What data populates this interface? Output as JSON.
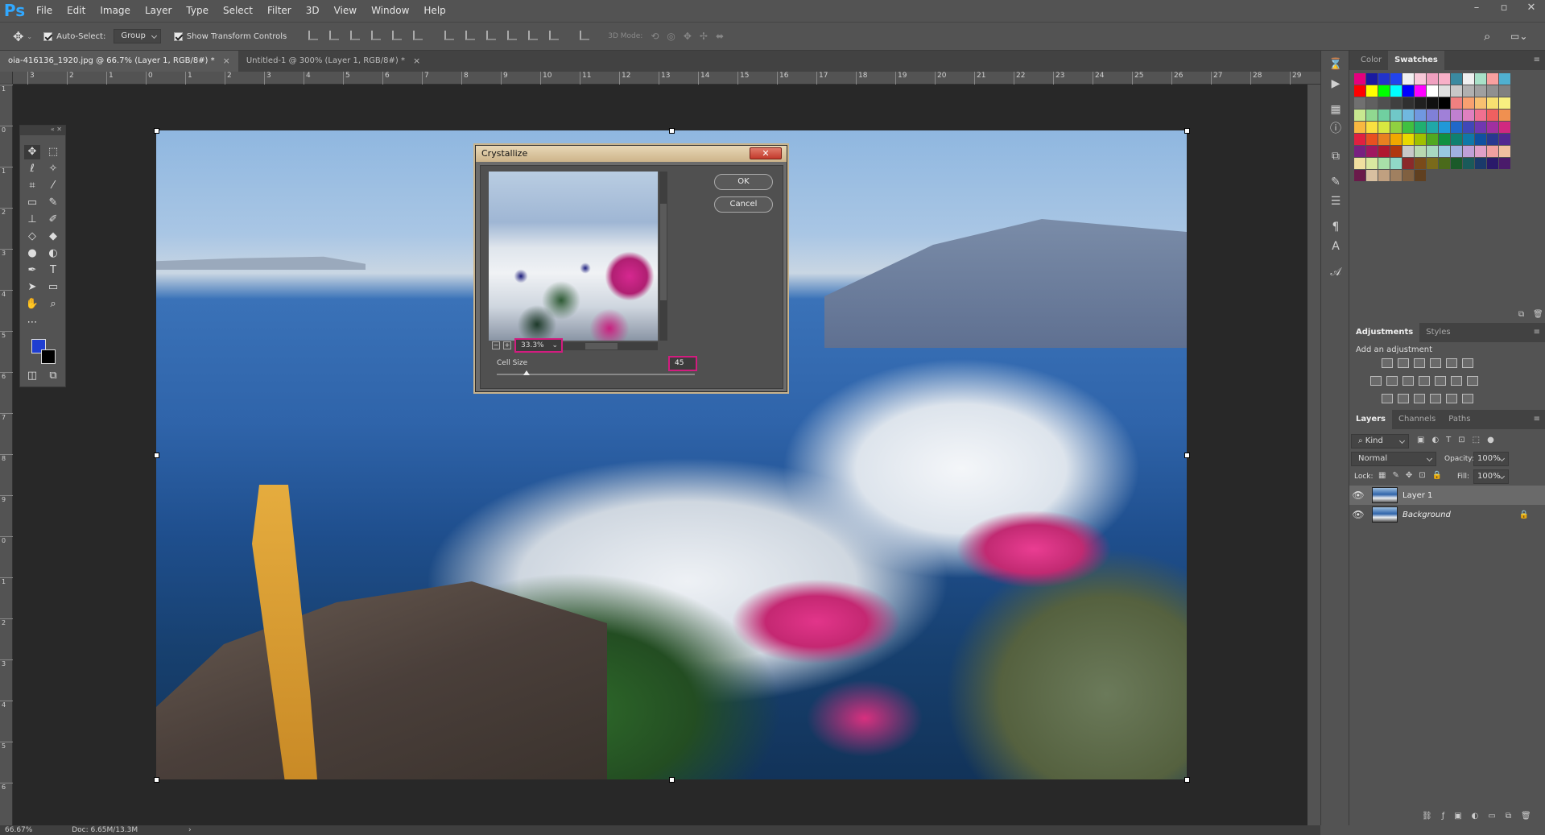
{
  "app": {
    "logo": "Ps"
  },
  "menu": [
    "File",
    "Edit",
    "Image",
    "Layer",
    "Type",
    "Select",
    "Filter",
    "3D",
    "View",
    "Window",
    "Help"
  ],
  "window_controls": [
    "–",
    "▫",
    "✕"
  ],
  "options": {
    "auto_select_label": "Auto-Select:",
    "auto_select_value": "Group",
    "show_transform_label": "Show Transform Controls",
    "mode_3d_label": "3D Mode:"
  },
  "tabs": [
    {
      "label": "oia-416136_1920.jpg @ 66.7% (Layer 1, RGB/8#) *",
      "close": "×"
    },
    {
      "label": "Untitled-1 @ 300% (Layer 1, RGB/8#) *",
      "close": "×"
    }
  ],
  "ruler_h": [
    "3",
    "2",
    "1",
    "0",
    "1",
    "2",
    "3",
    "4",
    "5",
    "6",
    "7",
    "8",
    "9",
    "10",
    "11",
    "12",
    "13",
    "14",
    "15",
    "16",
    "17",
    "18",
    "19",
    "20",
    "21",
    "22",
    "23",
    "24",
    "25",
    "26",
    "27",
    "28",
    "29"
  ],
  "ruler_v": [
    "1",
    "0",
    "1",
    "2",
    "3",
    "4",
    "5",
    "6",
    "7",
    "8",
    "9",
    "0",
    "1",
    "2",
    "3",
    "4",
    "5",
    "6"
  ],
  "dialog": {
    "title": "Crystallize",
    "close": "✕",
    "ok": "OK",
    "cancel": "Cancel",
    "zoom": "33.3%",
    "zoom_out": "−",
    "zoom_in": "+",
    "cell_size_label": "Cell Size",
    "cell_size_value": "45",
    "cell_size_percent": 0.15
  },
  "panels": {
    "color_tab": "Color",
    "swatches_tab": "Swatches",
    "adjustments_tab": "Adjustments",
    "styles_tab": "Styles",
    "add_adjustment": "Add an adjustment",
    "layers_tab": "Layers",
    "channels_tab": "Channels",
    "paths_tab": "Paths",
    "kind": "Kind",
    "blend_mode": "Normal",
    "opacity_label": "Opacity:",
    "opacity_value": "100%",
    "lock_label": "Lock:",
    "fill_label": "Fill:",
    "fill_value": "100%",
    "layers": [
      {
        "name": "Layer 1"
      },
      {
        "name": "Background"
      }
    ]
  },
  "status": {
    "zoom": "66.67%",
    "doc": "Doc: 6.65M/13.3M"
  },
  "colors": {
    "foreground": "#1f3ed1",
    "background": "#000000",
    "highlight": "#d21c7f"
  },
  "swatch_colors": [
    "#e6007e",
    "#1a1aa0",
    "#2233cc",
    "#2244ee",
    "#f0f0f0",
    "#f8c8d8",
    "#f0a0c0",
    "#f8b0c8",
    "#3a8aa0",
    "#f0f0f0",
    "#a8e0c8",
    "#f8a0a0",
    "#50b0d0",
    "#ff0000",
    "#ffff00",
    "#00ff00",
    "#00ffff",
    "#0000ff",
    "#ff00ff",
    "#ffffff",
    "#e0e0e0",
    "#c8c8c8",
    "#b0b0b0",
    "#a0a0a0",
    "#909090",
    "#808080",
    "#707070",
    "#606060",
    "#505050",
    "#404040",
    "#303030",
    "#202020",
    "#101010",
    "#000000",
    "#f08080",
    "#f8a070",
    "#f8c070",
    "#f8e070",
    "#f8f080",
    "#c8e890",
    "#90d890",
    "#70d0a0",
    "#70c8c8",
    "#70b8e0",
    "#7098e0",
    "#8080d8",
    "#a080d8",
    "#c080d0",
    "#e080c0",
    "#f07090",
    "#f06060",
    "#f09050",
    "#f8b840",
    "#f8e040",
    "#d8e840",
    "#90d040",
    "#40c040",
    "#20b070",
    "#20a8a8",
    "#2098d8",
    "#2068c8",
    "#4048b8",
    "#7038b0",
    "#a030a0",
    "#d02880",
    "#e02040",
    "#e85020",
    "#e88020",
    "#f0a800",
    "#e8d800",
    "#a0c000",
    "#50a820",
    "#109040",
    "#108070",
    "#1078a8",
    "#1050a0",
    "#283890",
    "#502890",
    "#782080",
    "#a01860",
    "#b01830",
    "#b03810"
  ]
}
